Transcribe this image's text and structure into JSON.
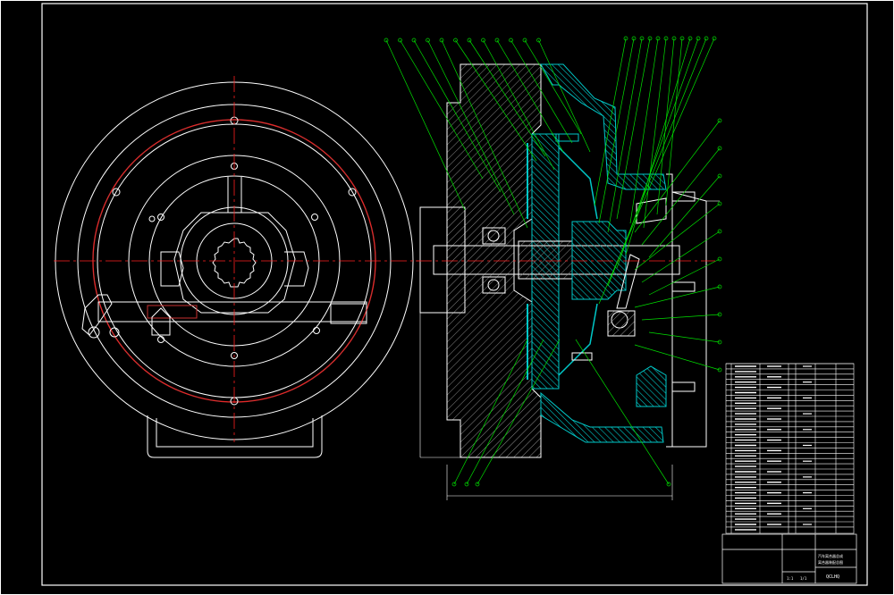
{
  "drawing": {
    "background": "#000000",
    "colors": {
      "frame": "#ffffff",
      "centerline": "#ff2020",
      "hatch": "#00c8c8",
      "leader": "#00e000",
      "outline": "#ffffff",
      "accent_red": "#c83030"
    },
    "views": [
      {
        "name": "front-view",
        "content": "circular clutch housing with splined hub and release fork"
      },
      {
        "name": "section-view",
        "content": "half sectional view of clutch assembly"
      }
    ],
    "balloon_count_top": 24,
    "balloon_count_right": 10,
    "balloon_count_bottom": 4
  },
  "title_block": {
    "title_line1": "汽车离合器总成",
    "title_line2": "离合器装配总图",
    "drawing_no": "QCLHQ",
    "scale": "1:1",
    "sheet": "1/1"
  }
}
